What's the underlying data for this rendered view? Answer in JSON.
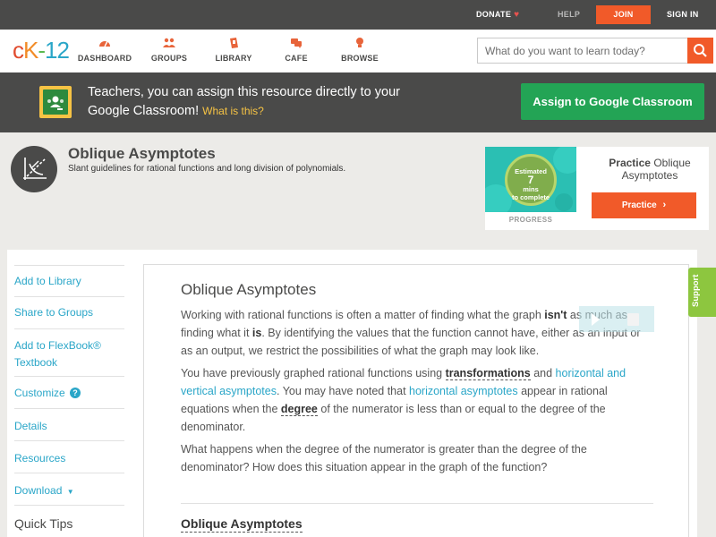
{
  "topbar": {
    "donate": "DONATE",
    "help": "HELP",
    "join": "JOIN",
    "signin": "SIGN IN"
  },
  "logo": {
    "c": "c",
    "k": "K",
    "dash": "-",
    "num": "12"
  },
  "nav": {
    "items": [
      {
        "label": "DASHBOARD",
        "icon": "dashboard-icon"
      },
      {
        "label": "GROUPS",
        "icon": "groups-icon"
      },
      {
        "label": "LIBRARY",
        "icon": "library-icon"
      },
      {
        "label": "CAFE",
        "icon": "cafe-icon"
      },
      {
        "label": "BROWSE",
        "icon": "browse-icon"
      }
    ],
    "search_placeholder": "What do you want to learn today?"
  },
  "banner": {
    "text": "Teachers, you can assign this resource directly to your Google Classroom!",
    "link": "What is this?",
    "button": "Assign to Google Classroom"
  },
  "header": {
    "title": "Oblique Asymptotes",
    "subtitle": "Slant guidelines for rational functions and long division of polynomials."
  },
  "practice": {
    "estimated_line1": "Estimated",
    "estimated_line2": "7",
    "estimated_line3": "mins",
    "estimated_line4": "to complete",
    "progress": "PROGRESS",
    "label_bold": "Practice",
    "label_rest": "Oblique Asymptotes",
    "button": "Practice"
  },
  "sidebar": {
    "items": [
      {
        "label": "Add to Library"
      },
      {
        "label": "Share to Groups"
      },
      {
        "label": "Add to FlexBook®"
      },
      {
        "label": "Textbook"
      },
      {
        "label": "Customize"
      },
      {
        "label": "Details"
      },
      {
        "label": "Resources"
      },
      {
        "label": "Download"
      }
    ],
    "quick_tips": "Quick Tips"
  },
  "content": {
    "title": "Oblique Asymptotes",
    "p1": {
      "a": "Working with rational functions is often a matter of finding what the graph ",
      "b": "isn't",
      "c": " as much as finding what it ",
      "d": "is",
      "e": ". By identifying the values that the function cannot have, either as an input or as an output, we restrict the possibilities of what the graph may look like."
    },
    "p2": {
      "a": "You have previously graphed rational functions using ",
      "b": "transformations",
      "c": " and ",
      "d": "horizontal and vertical asymptotes",
      "e": ". You may have noted that ",
      "f": "horizontal asymptotes",
      "g": " appear in rational equations when the ",
      "h": "degree",
      "i": " of the numerator is less than or equal to the degree of the denominator."
    },
    "p3": "What happens when the degree of the numerator is greater than the degree of the denominator? How does this situation appear in the graph of the function?",
    "sub_heading": "Oblique Asymptotes"
  },
  "support": "Support",
  "colors": {
    "accent_orange": "#f15a29",
    "link_blue": "#2aa6c8",
    "google_green": "#23a455",
    "support_green": "#8dc63f"
  }
}
